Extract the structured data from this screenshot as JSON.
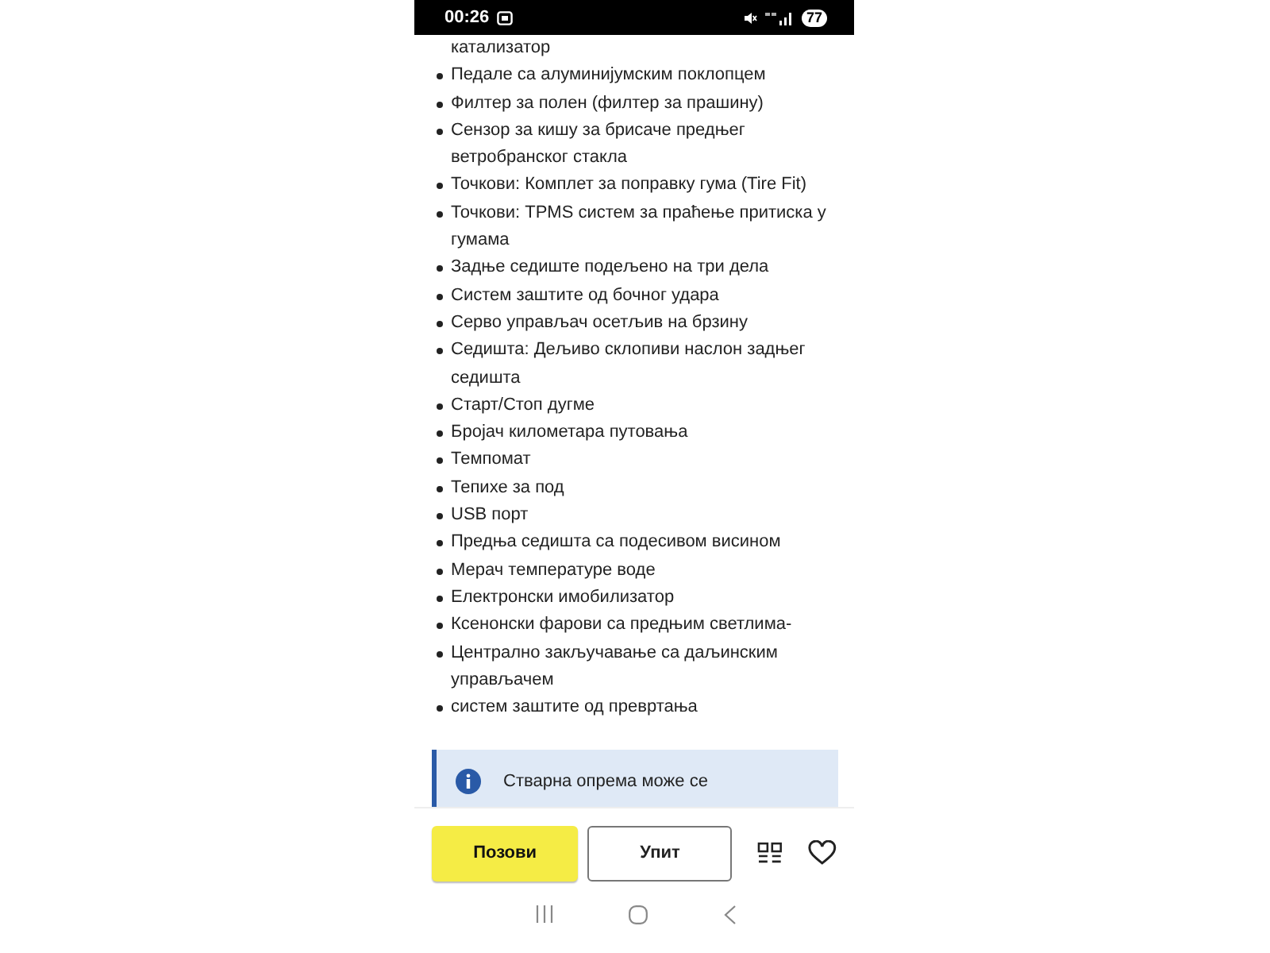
{
  "status_bar": {
    "time": "00:26",
    "battery": "77"
  },
  "features": [
    {
      "text": "катализатор",
      "kind": "continuation"
    },
    {
      "text": "Педале са алуминијумским поклопцем",
      "kind": "bullet"
    },
    {
      "text": "Филтер за полен (филтер за прашину)",
      "kind": "bullet"
    },
    {
      "text": "Сензор за кишу за брисаче предњег ветробранског стакла",
      "kind": "bullet"
    },
    {
      "text": "Точкови: Комплет за поправку гума (Tire Fit)",
      "kind": "bullet"
    },
    {
      "text": "Точкови: TPMS систем за праћење притиска у гумама",
      "kind": "bullet"
    },
    {
      "text": "Задње седиште подељено на три дела",
      "kind": "bullet"
    },
    {
      "text": "Систем заштите од бочног удара",
      "kind": "bullet"
    },
    {
      "text": "Серво управљач осетљив на брзину",
      "kind": "bullet"
    },
    {
      "text": "Седишта: Дељиво склопиви наслон задњег седишта",
      "kind": "bullet"
    },
    {
      "text": "Старт/Стоп дугме",
      "kind": "bullet"
    },
    {
      "text": "Бројач километара путовања",
      "kind": "bullet"
    },
    {
      "text": "Темпомат",
      "kind": "bullet"
    },
    {
      "text": "Тепихе за под",
      "kind": "bullet"
    },
    {
      "text": "USB порт",
      "kind": "bullet"
    },
    {
      "text": "Предња седишта са подесивом висином",
      "kind": "bullet"
    },
    {
      "text": "Мерач температуре воде",
      "kind": "bullet"
    },
    {
      "text": "Електронски имобилизатор",
      "kind": "bullet"
    },
    {
      "text": "Ксенонски фарови са предњим светлима-",
      "kind": "bullet"
    },
    {
      "text": "Централно закључавање са даљинским управљачем",
      "kind": "bullet"
    },
    {
      "text": "систем заштите од превртања",
      "kind": "bullet"
    }
  ],
  "notice": {
    "text": "Стварна опрема може се"
  },
  "actions": {
    "call": "Позови",
    "inquiry": "Упит"
  }
}
